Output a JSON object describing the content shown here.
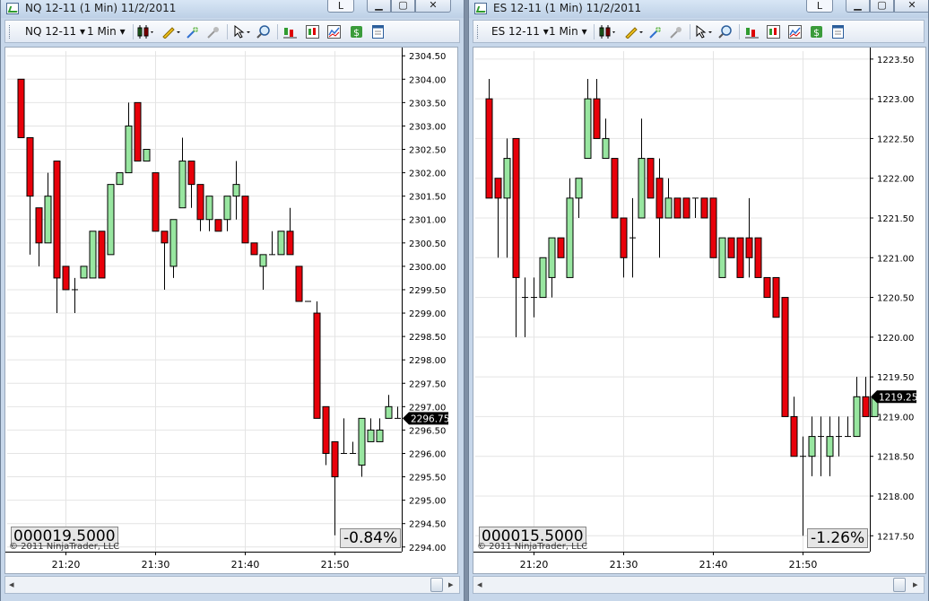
{
  "windows": [
    {
      "title": "NQ 12-11 (1 Min)  11/2/2011",
      "layout_button": "L",
      "toolbar": {
        "instrument": "NQ 12-11",
        "interval": "1 Min"
      },
      "price_box": "-0.84%",
      "counter": "000019.5000",
      "copyright": "© 2011 NinjaTrader, LLC",
      "last_price": "2296.75",
      "y_labels": [
        "2304.50",
        "2304.00",
        "2303.50",
        "2303.00",
        "2302.50",
        "2302.00",
        "2301.50",
        "2301.00",
        "2300.50",
        "2300.00",
        "2299.50",
        "2299.00",
        "2298.50",
        "2298.00",
        "2297.50",
        "2297.00",
        "2296.50",
        "2296.00",
        "2295.50",
        "2295.00",
        "2294.50",
        "2294.00"
      ],
      "x_labels": [
        "21:20",
        "21:30",
        "21:40",
        "21:50"
      ],
      "chart_data": {
        "type": "candlestick",
        "ylim": [
          2293.9,
          2304.6
        ],
        "ticks": [
          2304.5,
          2304.0,
          2303.5,
          2303.0,
          2302.5,
          2302.0,
          2301.5,
          2301.0,
          2300.5,
          2300.0,
          2299.5,
          2299.0,
          2298.5,
          2298.0,
          2297.5,
          2297.0,
          2296.5,
          2296.0,
          2295.5,
          2295.0,
          2294.5,
          2294.0
        ],
        "last": 2296.75,
        "bull_color": "#98e6a0",
        "bear_color": "#e8000a",
        "x_ticks": [
          5,
          15,
          25,
          35
        ],
        "candles": [
          {
            "o": 2304.0,
            "h": 2304.0,
            "l": 2302.75,
            "c": 2302.75
          },
          {
            "o": 2302.75,
            "h": 2302.75,
            "l": 2300.25,
            "c": 2301.5
          },
          {
            "o": 2301.25,
            "h": 2301.25,
            "l": 2300.0,
            "c": 2300.5
          },
          {
            "o": 2300.5,
            "h": 2302.0,
            "l": 2300.5,
            "c": 2301.5
          },
          {
            "o": 2302.25,
            "h": 2302.25,
            "l": 2299.0,
            "c": 2299.75
          },
          {
            "o": 2300.0,
            "h": 2300.0,
            "l": 2299.5,
            "c": 2299.5
          },
          {
            "o": 2299.5,
            "h": 2299.75,
            "l": 2299.0,
            "c": 2299.5
          },
          {
            "o": 2299.75,
            "h": 2300.0,
            "l": 2299.75,
            "c": 2300.0
          },
          {
            "o": 2299.75,
            "h": 2300.75,
            "l": 2299.75,
            "c": 2300.75
          },
          {
            "o": 2300.75,
            "h": 2300.75,
            "l": 2299.75,
            "c": 2299.75
          },
          {
            "o": 2300.25,
            "h": 2301.75,
            "l": 2300.25,
            "c": 2301.75
          },
          {
            "o": 2301.75,
            "h": 2302.0,
            "l": 2301.75,
            "c": 2302.0
          },
          {
            "o": 2302.0,
            "h": 2303.5,
            "l": 2302.0,
            "c": 2303.0
          },
          {
            "o": 2303.5,
            "h": 2303.5,
            "l": 2302.25,
            "c": 2302.25
          },
          {
            "o": 2302.25,
            "h": 2302.5,
            "l": 2302.25,
            "c": 2302.5
          },
          {
            "o": 2302.0,
            "h": 2302.0,
            "l": 2300.75,
            "c": 2300.75
          },
          {
            "o": 2300.75,
            "h": 2300.75,
            "l": 2299.5,
            "c": 2300.5
          },
          {
            "o": 2300.0,
            "h": 2301.0,
            "l": 2299.75,
            "c": 2301.0
          },
          {
            "o": 2301.25,
            "h": 2302.75,
            "l": 2301.25,
            "c": 2302.25
          },
          {
            "o": 2302.25,
            "h": 2302.25,
            "l": 2301.25,
            "c": 2301.75
          },
          {
            "o": 2301.75,
            "h": 2301.75,
            "l": 2300.75,
            "c": 2301.0
          },
          {
            "o": 2301.0,
            "h": 2301.5,
            "l": 2300.75,
            "c": 2301.5
          },
          {
            "o": 2301.0,
            "h": 2301.0,
            "l": 2300.75,
            "c": 2300.75
          },
          {
            "o": 2301.0,
            "h": 2301.5,
            "l": 2300.75,
            "c": 2301.5
          },
          {
            "o": 2301.5,
            "h": 2302.25,
            "l": 2301.0,
            "c": 2301.75
          },
          {
            "o": 2301.5,
            "h": 2301.5,
            "l": 2300.5,
            "c": 2300.5
          },
          {
            "o": 2300.5,
            "h": 2300.5,
            "l": 2300.25,
            "c": 2300.25
          },
          {
            "o": 2300.0,
            "h": 2300.25,
            "l": 2299.5,
            "c": 2300.25
          },
          {
            "o": 2300.25,
            "h": 2300.75,
            "l": 2300.25,
            "c": 2300.25
          },
          {
            "o": 2300.25,
            "h": 2300.75,
            "l": 2300.25,
            "c": 2300.75
          },
          {
            "o": 2300.75,
            "h": 2301.25,
            "l": 2300.25,
            "c": 2300.25
          },
          {
            "o": 2300.0,
            "h": 2300.0,
            "l": 2299.25,
            "c": 2299.25
          },
          {
            "o": 2299.25,
            "h": 2299.25,
            "l": 2299.25,
            "c": 2299.25
          },
          {
            "o": 2299.0,
            "h": 2299.25,
            "l": 2296.75,
            "c": 2296.75
          },
          {
            "o": 2297.0,
            "h": 2297.0,
            "l": 2295.75,
            "c": 2296.0
          },
          {
            "o": 2296.25,
            "h": 2296.25,
            "l": 2294.25,
            "c": 2295.5
          },
          {
            "o": 2296.0,
            "h": 2296.75,
            "l": 2296.0,
            "c": 2296.0
          },
          {
            "o": 2296.0,
            "h": 2296.25,
            "l": 2296.0,
            "c": 2296.0
          },
          {
            "o": 2295.75,
            "h": 2296.75,
            "l": 2295.5,
            "c": 2296.75
          },
          {
            "o": 2296.25,
            "h": 2296.75,
            "l": 2296.25,
            "c": 2296.5
          },
          {
            "o": 2296.25,
            "h": 2296.75,
            "l": 2296.25,
            "c": 2296.5
          },
          {
            "o": 2296.75,
            "h": 2297.25,
            "l": 2296.75,
            "c": 2297.0
          },
          {
            "o": 2296.75,
            "h": 2297.0,
            "l": 2296.75,
            "c": 2296.75
          }
        ]
      }
    },
    {
      "title": "ES 12-11 (1 Min)  11/2/2011",
      "layout_button": "L",
      "toolbar": {
        "instrument": "ES 12-11",
        "interval": "1 Min"
      },
      "price_box": "-1.26%",
      "counter": "000015.5000",
      "copyright": "© 2011 NinjaTrader, LLC",
      "last_price": "1219.25",
      "y_labels": [
        "1223.50",
        "1223.00",
        "1222.50",
        "1222.00",
        "1221.50",
        "1221.00",
        "1220.50",
        "1220.00",
        "1219.50",
        "1219.00",
        "1218.50",
        "1218.00",
        "1217.50"
      ],
      "x_labels": [
        "21:20",
        "21:30",
        "21:40",
        "21:50"
      ],
      "chart_data": {
        "type": "candlestick",
        "ylim": [
          1217.3,
          1223.6
        ],
        "ticks": [
          1223.5,
          1223.0,
          1222.5,
          1222.0,
          1221.5,
          1221.0,
          1220.5,
          1220.0,
          1219.5,
          1219.0,
          1218.5,
          1218.0,
          1217.5
        ],
        "last": 1219.25,
        "bull_color": "#98e6a0",
        "bear_color": "#e8000a",
        "x_ticks": [
          5,
          15,
          25,
          35
        ],
        "candles": [
          {
            "o": 1223.0,
            "h": 1223.25,
            "l": 1221.75,
            "c": 1221.75
          },
          {
            "o": 1222.0,
            "h": 1222.0,
            "l": 1221.0,
            "c": 1221.75
          },
          {
            "o": 1221.75,
            "h": 1222.5,
            "l": 1221.0,
            "c": 1222.25
          },
          {
            "o": 1222.5,
            "h": 1222.5,
            "l": 1220.0,
            "c": 1220.75
          },
          {
            "o": 1220.5,
            "h": 1220.75,
            "l": 1220.0,
            "c": 1220.5
          },
          {
            "o": 1220.5,
            "h": 1220.75,
            "l": 1220.25,
            "c": 1220.5
          },
          {
            "o": 1220.5,
            "h": 1221.0,
            "l": 1220.5,
            "c": 1221.0
          },
          {
            "o": 1220.75,
            "h": 1221.25,
            "l": 1220.5,
            "c": 1221.25
          },
          {
            "o": 1221.25,
            "h": 1221.25,
            "l": 1221.0,
            "c": 1221.0
          },
          {
            "o": 1220.75,
            "h": 1222.0,
            "l": 1220.75,
            "c": 1221.75
          },
          {
            "o": 1221.75,
            "h": 1222.0,
            "l": 1221.5,
            "c": 1222.0
          },
          {
            "o": 1222.25,
            "h": 1223.25,
            "l": 1222.25,
            "c": 1223.0
          },
          {
            "o": 1223.0,
            "h": 1223.25,
            "l": 1222.5,
            "c": 1222.5
          },
          {
            "o": 1222.25,
            "h": 1222.75,
            "l": 1222.25,
            "c": 1222.5
          },
          {
            "o": 1222.25,
            "h": 1222.25,
            "l": 1221.5,
            "c": 1221.5
          },
          {
            "o": 1221.5,
            "h": 1221.5,
            "l": 1220.75,
            "c": 1221.0
          },
          {
            "o": 1221.25,
            "h": 1221.75,
            "l": 1220.75,
            "c": 1221.25
          },
          {
            "o": 1221.5,
            "h": 1222.75,
            "l": 1221.5,
            "c": 1222.25
          },
          {
            "o": 1222.25,
            "h": 1222.25,
            "l": 1221.75,
            "c": 1221.75
          },
          {
            "o": 1222.0,
            "h": 1222.25,
            "l": 1221.0,
            "c": 1221.5
          },
          {
            "o": 1221.5,
            "h": 1222.0,
            "l": 1221.5,
            "c": 1221.75
          },
          {
            "o": 1221.75,
            "h": 1221.75,
            "l": 1221.5,
            "c": 1221.5
          },
          {
            "o": 1221.75,
            "h": 1221.75,
            "l": 1221.5,
            "c": 1221.5
          },
          {
            "o": 1221.75,
            "h": 1221.75,
            "l": 1221.5,
            "c": 1221.75
          },
          {
            "o": 1221.75,
            "h": 1221.75,
            "l": 1221.5,
            "c": 1221.5
          },
          {
            "o": 1221.75,
            "h": 1221.75,
            "l": 1221.25,
            "c": 1221.0
          },
          {
            "o": 1220.75,
            "h": 1221.0,
            "l": 1220.75,
            "c": 1221.25
          },
          {
            "o": 1221.25,
            "h": 1221.25,
            "l": 1221.0,
            "c": 1221.0
          },
          {
            "o": 1221.25,
            "h": 1221.25,
            "l": 1220.75,
            "c": 1220.75
          },
          {
            "o": 1221.25,
            "h": 1221.75,
            "l": 1220.75,
            "c": 1221.0
          },
          {
            "o": 1221.25,
            "h": 1221.25,
            "l": 1220.75,
            "c": 1220.75
          },
          {
            "o": 1220.75,
            "h": 1220.75,
            "l": 1220.5,
            "c": 1220.5
          },
          {
            "o": 1220.75,
            "h": 1220.75,
            "l": 1220.25,
            "c": 1220.25
          },
          {
            "o": 1220.5,
            "h": 1220.5,
            "l": 1219.0,
            "c": 1219.0
          },
          {
            "o": 1219.0,
            "h": 1219.25,
            "l": 1218.5,
            "c": 1218.5
          },
          {
            "o": 1218.5,
            "h": 1218.75,
            "l": 1217.5,
            "c": 1218.5
          },
          {
            "o": 1218.5,
            "h": 1219.0,
            "l": 1218.25,
            "c": 1218.75
          },
          {
            "o": 1218.75,
            "h": 1219.0,
            "l": 1218.25,
            "c": 1218.75
          },
          {
            "o": 1218.5,
            "h": 1219.0,
            "l": 1218.25,
            "c": 1218.75
          },
          {
            "o": 1218.75,
            "h": 1219.0,
            "l": 1218.5,
            "c": 1218.75
          },
          {
            "o": 1218.75,
            "h": 1219.0,
            "l": 1218.75,
            "c": 1218.75
          },
          {
            "o": 1218.75,
            "h": 1219.5,
            "l": 1218.75,
            "c": 1219.25
          },
          {
            "o": 1219.25,
            "h": 1219.5,
            "l": 1219.0,
            "c": 1219.0
          },
          {
            "o": 1219.0,
            "h": 1219.25,
            "l": 1219.0,
            "c": 1219.25
          }
        ]
      }
    }
  ]
}
